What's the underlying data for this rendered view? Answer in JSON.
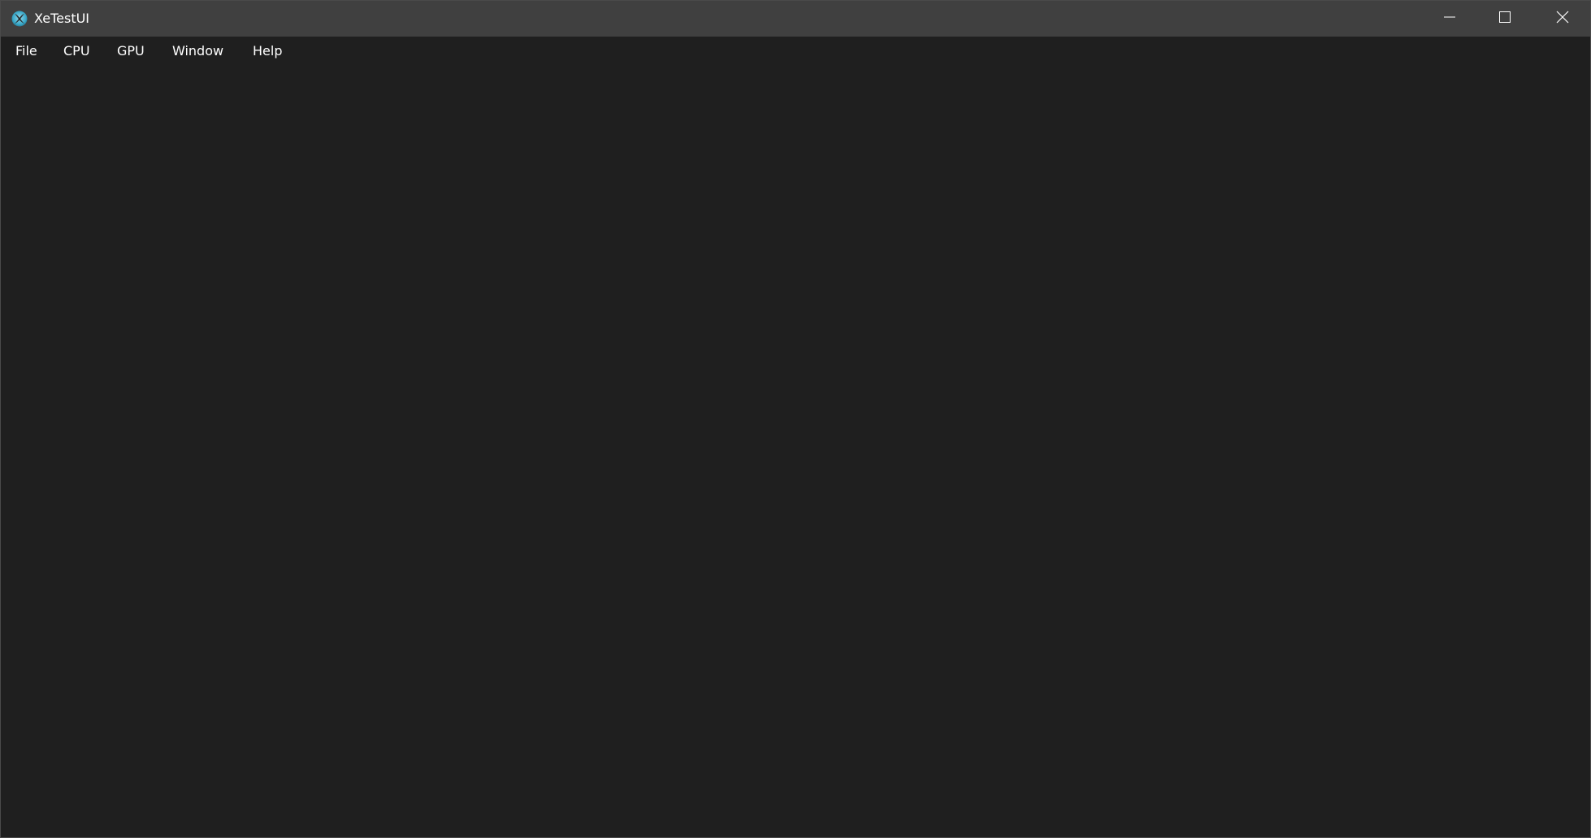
{
  "window": {
    "title": "XeTestUI",
    "app_icon": "xbox-logo-icon",
    "controls": {
      "minimize": "minimize-icon",
      "maximize": "maximize-icon",
      "close": "close-icon"
    }
  },
  "menubar": {
    "items": [
      {
        "label": "File"
      },
      {
        "label": "CPU"
      },
      {
        "label": "GPU"
      },
      {
        "label": "Window"
      },
      {
        "label": "Help"
      }
    ]
  },
  "colors": {
    "titlebar_bg": "#404040",
    "body_bg": "#1f1f1f",
    "text": "#ffffff",
    "icon_accent": "#3aa8c8"
  }
}
